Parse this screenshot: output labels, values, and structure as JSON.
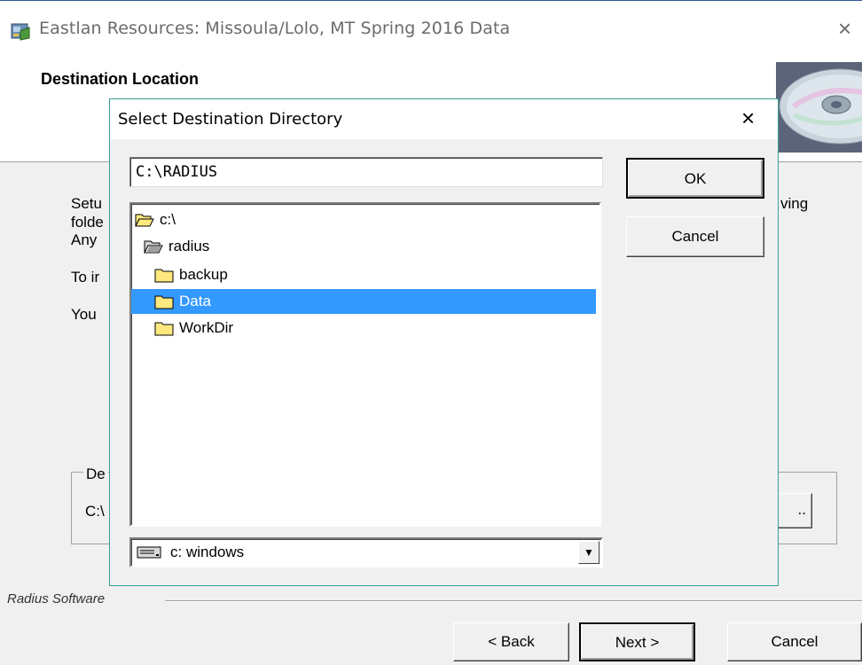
{
  "window": {
    "title": "Eastlan Resources: Missoula/Lolo, MT Spring 2016 Data",
    "close_glyph": "×",
    "icon": "installer-icon"
  },
  "header": {
    "title": "Destination Location",
    "image_icon": "cd-disc-icon"
  },
  "body": {
    "line1_visible_start": "Setu",
    "line1_visible_end": "ving",
    "line2_visible_start": "folde",
    "line3_visible_start": "Any",
    "line4_visible_start": "To ir",
    "line5_visible_start": "You"
  },
  "destination_frame": {
    "label_visible": "De",
    "value_visible": "C:\\",
    "browse_visible": ".."
  },
  "brand": {
    "label": "Radius Software"
  },
  "nav": {
    "back_label": "< Back",
    "next_label": "Next >",
    "cancel_label": "Cancel"
  },
  "dialog": {
    "title": "Select Destination Directory",
    "close_glyph": "×",
    "path_value": "C:\\RADIUS",
    "ok_label": "OK",
    "cancel_label": "Cancel",
    "tree": [
      {
        "label": "c:\\",
        "icon": "open-folder-icon",
        "level": 0,
        "selected": false
      },
      {
        "label": "radius",
        "icon": "open-folder-icon",
        "level": 1,
        "selected": false
      },
      {
        "label": "backup",
        "icon": "folder-icon",
        "level": 2,
        "selected": false
      },
      {
        "label": "Data",
        "icon": "folder-icon",
        "level": 2,
        "selected": true
      },
      {
        "label": "WorkDir",
        "icon": "folder-icon",
        "level": 2,
        "selected": false
      }
    ],
    "drive": {
      "label": "c:  windows",
      "icon": "drive-icon",
      "arrow": "▼"
    }
  },
  "colors": {
    "selection": "#3399ff",
    "dialog_border": "#3a9f95",
    "folder_yellow": "#ffe97f"
  }
}
